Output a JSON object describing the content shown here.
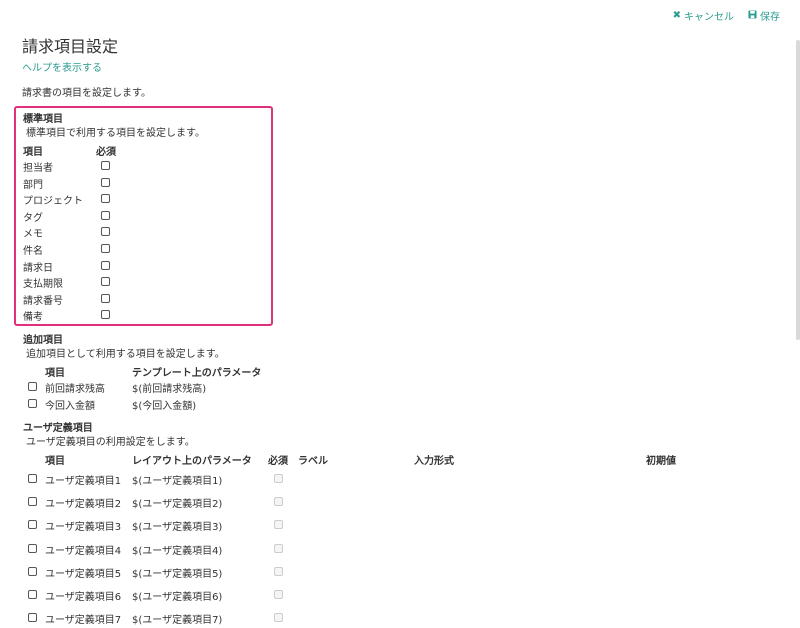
{
  "toolbar": {
    "cancel": "キャンセル",
    "save": "保存"
  },
  "page": {
    "title": "請求項目設定",
    "help_link": "ヘルプを表示する",
    "description": "請求書の項目を設定します。"
  },
  "standard": {
    "heading": "標準項目",
    "description": "標準項目で利用する項目を設定します。",
    "col_item": "項目",
    "col_required": "必須",
    "rows": [
      "担当者",
      "部門",
      "プロジェクト",
      "タグ",
      "メモ",
      "件名",
      "請求日",
      "支払期限",
      "請求番号",
      "備考"
    ]
  },
  "additional": {
    "heading": "追加項目",
    "description": "追加項目として利用する項目を設定します。",
    "col_item": "項目",
    "col_param": "テンプレート上のパラメータ",
    "rows": [
      {
        "name": "前回請求残高",
        "param": "$(前回請求残高)"
      },
      {
        "name": "今回入金額",
        "param": "$(今回入金額)"
      }
    ]
  },
  "user": {
    "heading": "ユーザ定義項目",
    "description": "ユーザ定義項目の利用設定をします。",
    "col_item": "項目",
    "col_param": "レイアウト上のパラメータ",
    "col_required": "必須",
    "col_label": "ラベル",
    "col_input": "入力形式",
    "col_default": "初期値",
    "rows": [
      {
        "name": "ユーザ定義項目1",
        "param": "$(ユーザ定義項目1)"
      },
      {
        "name": "ユーザ定義項目2",
        "param": "$(ユーザ定義項目2)"
      },
      {
        "name": "ユーザ定義項目3",
        "param": "$(ユーザ定義項目3)"
      },
      {
        "name": "ユーザ定義項目4",
        "param": "$(ユーザ定義項目4)"
      },
      {
        "name": "ユーザ定義項目5",
        "param": "$(ユーザ定義項目5)"
      },
      {
        "name": "ユーザ定義項目6",
        "param": "$(ユーザ定義項目6)"
      },
      {
        "name": "ユーザ定義項目7",
        "param": "$(ユーザ定義項目7)"
      }
    ]
  }
}
